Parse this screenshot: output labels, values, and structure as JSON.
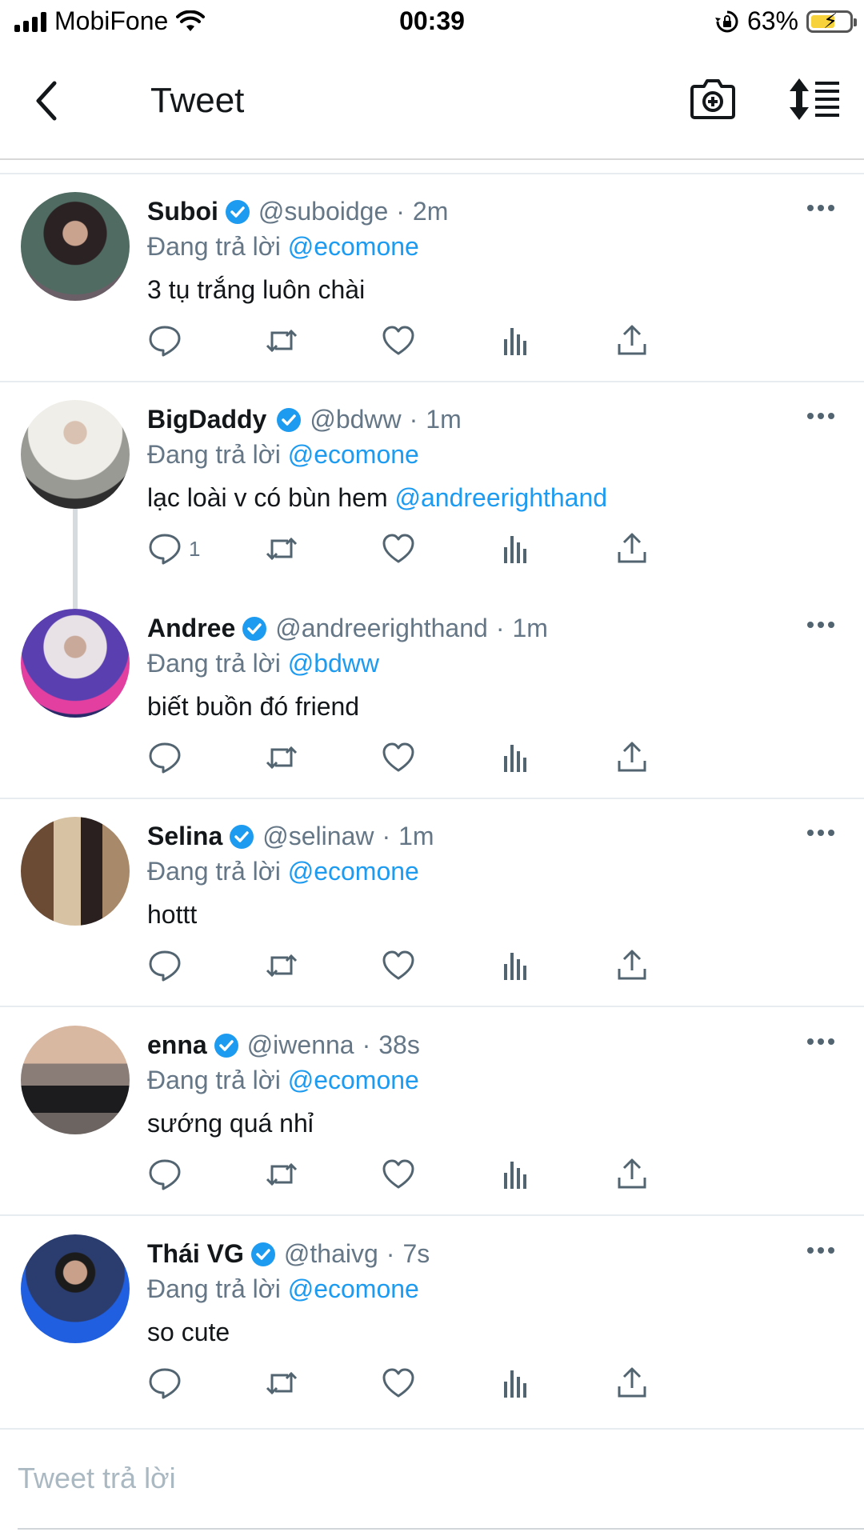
{
  "status_bar": {
    "carrier": "MobiFone",
    "time": "00:39",
    "battery_percent": "63%",
    "battery_level": 0.63,
    "icons": [
      "signal-icon",
      "wifi-icon",
      "rotation-lock-icon",
      "battery-charging-icon"
    ]
  },
  "header": {
    "title": "Tweet",
    "icons": [
      "back-icon",
      "camera-icon",
      "sort-icon"
    ]
  },
  "reply_prefix": "Đang trả lời",
  "tweets": [
    {
      "name": "Suboi",
      "handle": "@suboidge",
      "dot": "·",
      "time": "2m",
      "reply_to": "@ecomone",
      "text": "3 tụ trắng luôn chài",
      "text_mention": "",
      "reply_count": ""
    },
    {
      "name": "BigDaddy",
      "handle": "@bdww",
      "dot": "·",
      "time": "1m",
      "reply_to": "@ecomone",
      "text": "lạc loài v có bùn hem ",
      "text_mention": "@andreerighthand",
      "reply_count": "1"
    },
    {
      "name": "Andree",
      "handle": "@andreerighthand",
      "dot": "·",
      "time": "1m",
      "reply_to": "@bdww",
      "text": "biết buồn đó friend",
      "text_mention": "",
      "reply_count": ""
    },
    {
      "name": "Selina",
      "handle": "@selinaw",
      "dot": "·",
      "time": "1m",
      "reply_to": "@ecomone",
      "text": "hottt",
      "text_mention": "",
      "reply_count": ""
    },
    {
      "name": "enna",
      "handle": "@iwenna",
      "dot": "·",
      "time": "38s",
      "reply_to": "@ecomone",
      "text": "sướng quá nhỉ",
      "text_mention": "",
      "reply_count": ""
    },
    {
      "name": "Thái VG",
      "handle": "@thaivg",
      "dot": "·",
      "time": "7s",
      "reply_to": "@ecomone",
      "text": "so cute",
      "text_mention": "",
      "reply_count": ""
    }
  ],
  "reply_bar": {
    "placeholder": "Tweet trả lời"
  },
  "colors": {
    "accent": "#1d9bf0",
    "secondary_text": "#657786",
    "verified": "#1d9bf0"
  }
}
